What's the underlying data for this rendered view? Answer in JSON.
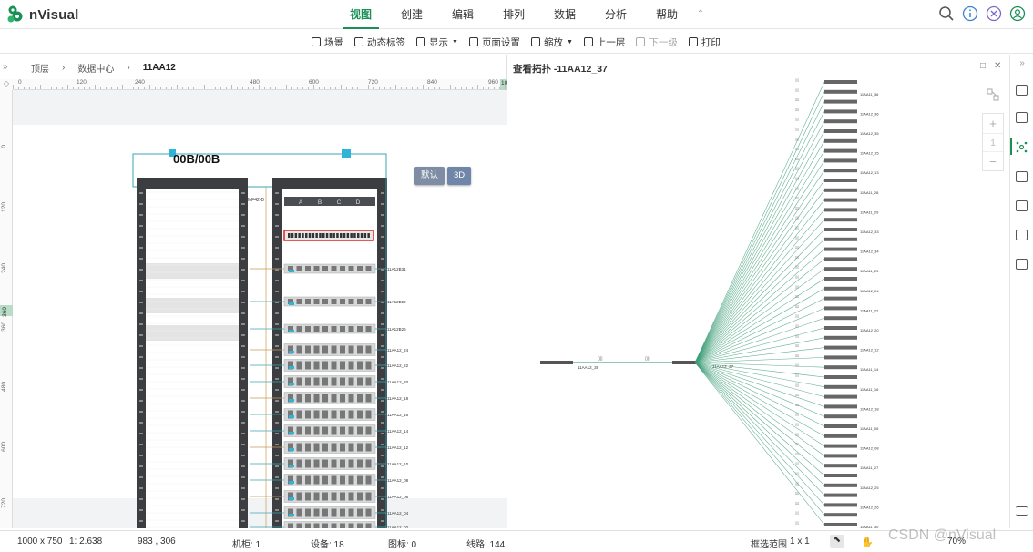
{
  "app": {
    "name": "nVisual",
    "brand_color": "#1a8f55"
  },
  "menu": {
    "items": [
      {
        "label": "视图",
        "active": true
      },
      {
        "label": "创建",
        "active": false
      },
      {
        "label": "编辑",
        "active": false
      },
      {
        "label": "排列",
        "active": false
      },
      {
        "label": "数据",
        "active": false
      },
      {
        "label": "分析",
        "active": false
      },
      {
        "label": "帮助",
        "active": false
      }
    ],
    "collapse_glyph": "⌃"
  },
  "top_icons": [
    "search-icon",
    "info-icon",
    "close-circle-icon",
    "user-icon"
  ],
  "toolbar": {
    "items": [
      {
        "label": "场景",
        "icon": "scene-icon",
        "caret": false,
        "disabled": false
      },
      {
        "label": "动态标签",
        "icon": "tag-icon",
        "caret": false,
        "disabled": false
      },
      {
        "label": "显示",
        "icon": "display-icon",
        "caret": true,
        "disabled": false
      },
      {
        "label": "页面设置",
        "icon": "page-settings-icon",
        "caret": false,
        "disabled": false
      },
      {
        "label": "缩放",
        "icon": "zoom-icon",
        "caret": true,
        "disabled": false
      },
      {
        "label": "上一层",
        "icon": "up-level-icon",
        "caret": false,
        "disabled": false
      },
      {
        "label": "下一级",
        "icon": "down-level-icon",
        "caret": false,
        "disabled": true
      },
      {
        "label": "打印",
        "icon": "print-icon",
        "caret": false,
        "disabled": false
      }
    ]
  },
  "breadcrumb": [
    "顶层",
    "数据中心",
    "11AA12"
  ],
  "rulers": {
    "top_labels": [
      "0",
      "120",
      "240",
      "480",
      "600",
      "720",
      "840",
      "960"
    ],
    "left_labels": [
      "0",
      "120",
      "240",
      "360",
      "480",
      "600",
      "720"
    ],
    "top_marker": "10",
    "left_marker": "360"
  },
  "canvas": {
    "buttons": [
      {
        "label": "默认"
      },
      {
        "label": "3D"
      }
    ],
    "rack_header": "00B/00B",
    "rack_right_columns": [
      "A",
      "B",
      "C",
      "D"
    ],
    "rack_small_label": "MF42-D",
    "device_labels": [
      "11A12B31",
      "11A12B29",
      "11A12B26",
      "11AA12_24",
      "11AA12_22",
      "11AA12_20",
      "11AA12_18",
      "11AA12_16",
      "11AA12_14",
      "11AA12_12",
      "11AA12_10",
      "11AA12_08",
      "11AA12_06",
      "11AA12_04",
      "11AA12_02"
    ]
  },
  "right_panel": {
    "title": "查看拓扑 -11AA12_37",
    "controls": [
      "□",
      "✕"
    ],
    "collapse_glyph": "»",
    "hub_labels": [
      "11AA12_38",
      "11AA12_37"
    ],
    "fan_labels": [
      "11AA11_36",
      "11AA12_36",
      "11AA12_35",
      "11AA12_15",
      "11AA12_13",
      "11AA11_28",
      "11AA11_29",
      "11AA12_33",
      "11AA12_34",
      "11AA11_23",
      "11AA12_24",
      "11AA11_22",
      "11AA12_20",
      "11AA12_12",
      "11AA11_14",
      "11AA11_16",
      "11AA12_18",
      "11AA11_05",
      "11AA12_08",
      "11AA11_27",
      "11AA12_25",
      "11AA12_26",
      "11AA11_30",
      "11AA12_15"
    ]
  },
  "sidebar": {
    "zoom_plus": "+",
    "zoom_value": "1",
    "zoom_minus": "−"
  },
  "statusbar": {
    "page_size": "1000 x 750",
    "scale": "1: 2.638",
    "coords": "983 , 306",
    "racks": "机柜: 1",
    "devices": "设备: 18",
    "icons": "图标: 0",
    "lines": "线路: 144",
    "select_label": "框选范围",
    "select_value": "1 x 1",
    "zoom": "70%"
  },
  "watermark": "CSDN @nVisual"
}
